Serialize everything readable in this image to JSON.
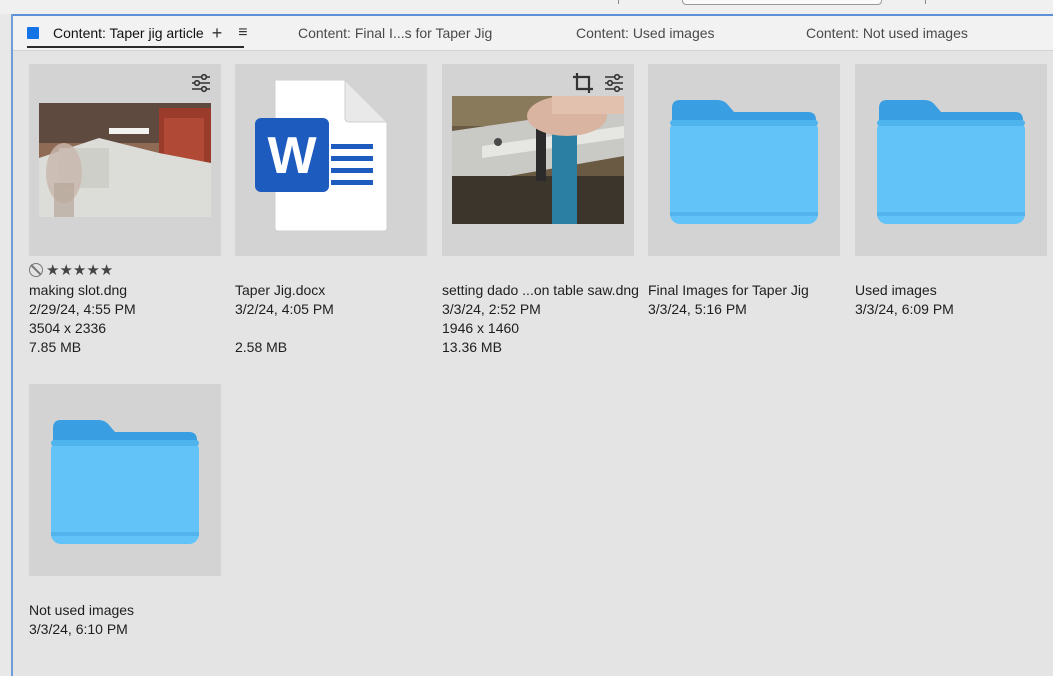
{
  "tabs": [
    {
      "label": "Content: Taper jig article",
      "active": true
    },
    {
      "label": "Content: Final I...s for Taper Jig"
    },
    {
      "label": "Content: Used images"
    },
    {
      "label": "Content: Not used images"
    }
  ],
  "icons": {
    "new_tab": "plus-icon",
    "panel_menu": "hamburger-menu-icon",
    "settings": "adjustments-sliders-icon",
    "crop": "crop-icon",
    "reject": "reject-icon",
    "star": "star-icon",
    "folder": "folder-icon",
    "word": "word-document-icon"
  },
  "glyphs": {
    "plus": "+",
    "menu": "≡",
    "star": "★",
    "word_letter": "W"
  },
  "colors": {
    "accent": "#1473e6",
    "folder": "#61c3f7",
    "folder_tab": "#3a9fe2",
    "word_blue": "#1e5bbf"
  },
  "items": [
    {
      "name": "making slot.dng",
      "date": "2/29/24, 4:55 PM",
      "dimensions": "3504 x 2336",
      "size": "7.85 MB",
      "rating": 5
    },
    {
      "name": "Taper Jig.docx",
      "date": "3/2/24, 4:05 PM",
      "dimensions": "",
      "size": "2.58 MB"
    },
    {
      "name": "setting dado ...on table saw.dng",
      "date": "3/3/24, 2:52 PM",
      "dimensions": "1946 x 1460",
      "size": "13.36 MB"
    },
    {
      "name": "Final Images for Taper Jig",
      "date": "3/3/24, 5:16 PM"
    },
    {
      "name": "Used images",
      "date": "3/3/24, 6:09 PM"
    },
    {
      "name": "Not used images",
      "date": "3/3/24, 6:10 PM"
    }
  ]
}
